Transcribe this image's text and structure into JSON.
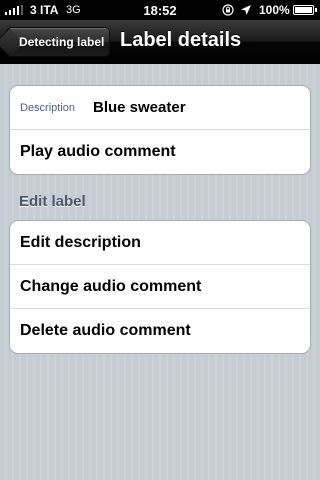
{
  "status_bar": {
    "carrier": "3 ITA",
    "network": "3G",
    "time": "18:52",
    "battery": "100%",
    "icons": [
      "signal-bars-icon",
      "rotation-lock-icon",
      "location-arrow-icon",
      "battery-icon"
    ]
  },
  "nav": {
    "back_label": "Detecting label",
    "title": "Label details"
  },
  "info_group": {
    "description_key": "Description",
    "description_value": "Blue sweater",
    "play_label": "Play audio comment"
  },
  "edit_group": {
    "header": "Edit label",
    "items": [
      {
        "label": "Edit description"
      },
      {
        "label": "Change audio comment"
      },
      {
        "label": "Delete audio comment"
      }
    ]
  },
  "colors": {
    "background": "#c5ccd4",
    "key_label": "#4c5e86",
    "section_header": "#4c566c"
  }
}
